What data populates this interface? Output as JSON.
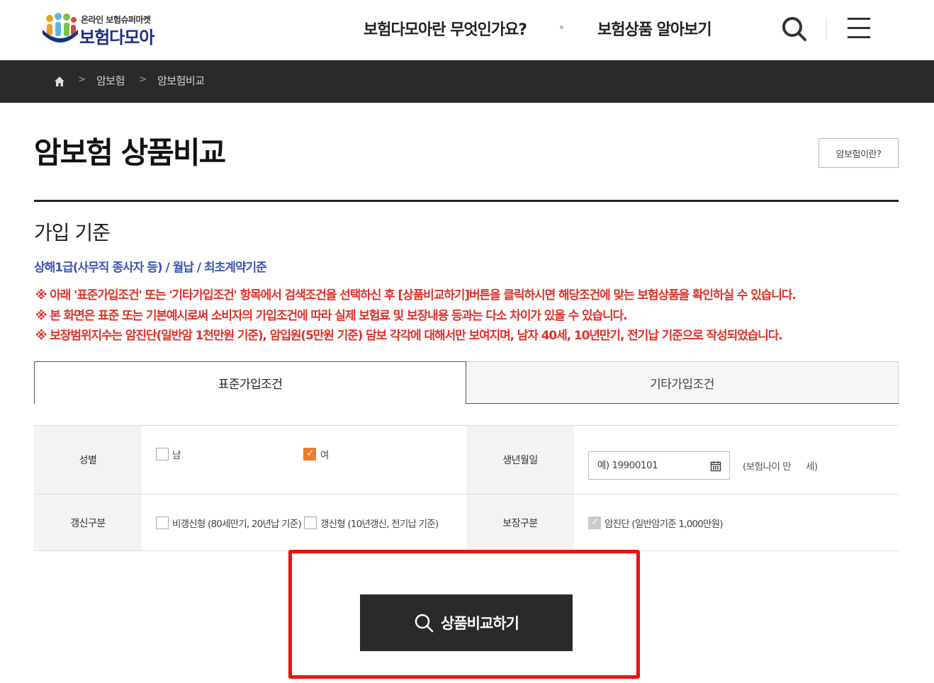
{
  "header": {
    "logo_sub": "온라인 보험슈퍼마켓",
    "logo_main": "보험다모아",
    "nav": [
      "보험다모아란 무엇인가요?",
      "보험상품 알아보기"
    ],
    "search_icon": "search-icon",
    "menu_icon": "hamburger-menu-icon"
  },
  "breadcrumb": {
    "home_icon": "home-icon",
    "items": [
      "암보험",
      "암보험비교"
    ]
  },
  "page": {
    "title": "암보험 상품비교",
    "about_button": "암보험이란?",
    "section_title": "가입 기준",
    "criteria": "상해1급(사무직 종사자 등) / 월납 / 최초계약기준",
    "notices": [
      "※ 아래 '표준가입조건' 또는 '기타가입조건' 항목에서 검색조건을 선택하신 후 [상품비교하기]버튼을 클릭하시면 해당조건에 맞는 보험상품을 확인하실 수 있습니다.",
      "※ 본 화면은 표준 또는 기본예시로써 소비자의 가입조건에 따라 실제 보험료 및 보장내용 등과는 다소 차이가 있을 수 있습니다.",
      "※ 보장범위지수는 암진단(일반암 1천만원 기준), 암입원(5만원 기준) 담보 각각에 대해서만 보여지며, 남자 40세, 10년만기, 전기납 기준으로 작성되었습니다."
    ]
  },
  "tabs": {
    "standard": "표준가입조건",
    "other": "기타가입조건",
    "active": "표준가입조건"
  },
  "form": {
    "gender_label": "성별",
    "gender_options": [
      "남",
      "여"
    ],
    "gender_selected": "여",
    "birth_label": "생년월일",
    "birth_placeholder": "예) 19900101",
    "birth_value": "",
    "age_prefix": "(보험나이 만",
    "age_value": "",
    "age_suffix": "세)",
    "renewal_label": "갱신구분",
    "renewal_options": [
      "비갱신형 (80세만기, 20년납 기준)",
      "갱신형 (10년갱신, 전기납 기준)"
    ],
    "coverage_label": "보장구분",
    "coverage_option": "암진단 (일반암기준 1,000만원)",
    "coverage_checked": true,
    "accent_color": "#ee7c2b"
  },
  "compare_button": {
    "label": "상품비교하기",
    "icon": "search-icon",
    "highlight_color": "#e11111"
  },
  "colors": {
    "breadcrumb_bg": "#2a2a2a",
    "notice": "#e0322a",
    "criteria": "#3b57b4",
    "logo": "#1c2f86"
  }
}
